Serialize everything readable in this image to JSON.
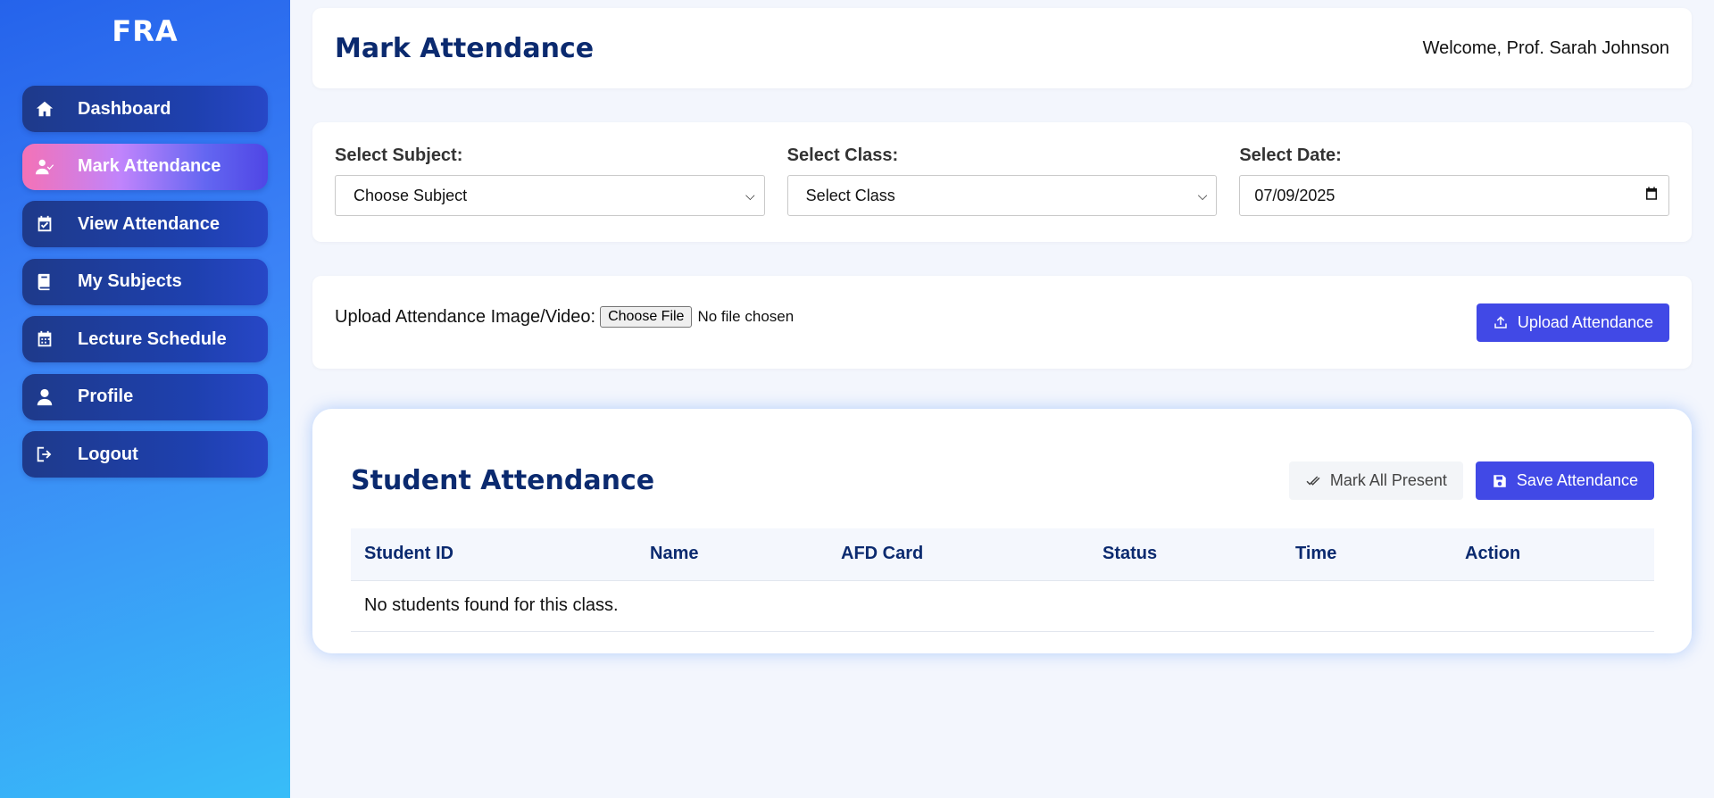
{
  "sidebar": {
    "brand": "FRA",
    "items": [
      {
        "label": "Dashboard",
        "icon": "home-icon"
      },
      {
        "label": "Mark Attendance",
        "icon": "user-check-icon",
        "active": true
      },
      {
        "label": "View Attendance",
        "icon": "calendar-check-icon"
      },
      {
        "label": "My Subjects",
        "icon": "book-icon"
      },
      {
        "label": "Lecture Schedule",
        "icon": "calendar-icon"
      },
      {
        "label": "Profile",
        "icon": "user-icon"
      },
      {
        "label": "Logout",
        "icon": "logout-icon"
      }
    ]
  },
  "header": {
    "title": "Mark Attendance",
    "welcome": "Welcome, Prof. Sarah Johnson"
  },
  "filters": {
    "subject": {
      "label": "Select Subject:",
      "value": "Choose Subject"
    },
    "class": {
      "label": "Select Class:",
      "value": "Select Class"
    },
    "date": {
      "label": "Select Date:",
      "value": "07/09/2025"
    }
  },
  "upload": {
    "label": "Upload Attendance Image/Video:",
    "file_button": "Choose File",
    "file_status": "No file chosen",
    "submit_label": "Upload Attendance"
  },
  "attendance": {
    "title": "Student Attendance",
    "mark_all_label": "Mark All Present",
    "save_label": "Save Attendance",
    "columns": [
      "Student ID",
      "Name",
      "AFD Card",
      "Status",
      "Time",
      "Action"
    ],
    "empty_message": "No students found for this class."
  },
  "colors": {
    "accent": "#4149e6",
    "title": "#0b2a6f",
    "sidebar_top": "#2563eb",
    "sidebar_bottom": "#38bdf8"
  }
}
